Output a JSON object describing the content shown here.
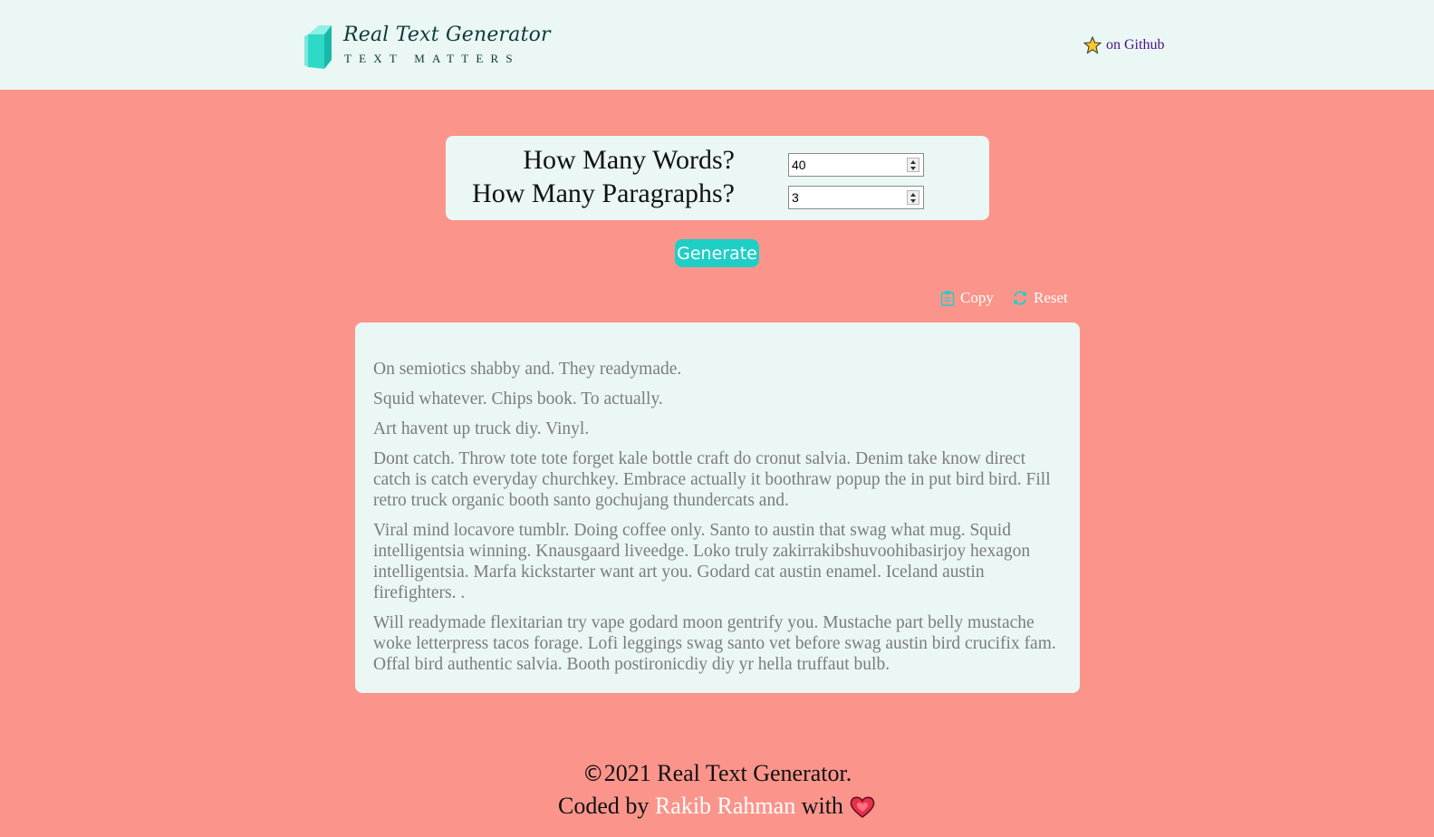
{
  "header": {
    "logo_title": "Real Text Generator",
    "logo_tagline": "TEXT MATTERS",
    "github_label": "on Github"
  },
  "form": {
    "words_label": "How Many Words?",
    "words_value": "40",
    "paragraphs_label": "How Many Paragraphs?",
    "paragraphs_value": "3"
  },
  "generate_label": "Generate",
  "actions": {
    "copy_label": "Copy",
    "reset_label": "Reset"
  },
  "output": {
    "paragraphs": [
      "On semiotics shabby and. They readymade.",
      "Squid whatever. Chips book. To actually.",
      "Art havent up truck diy. Vinyl.",
      "Dont catch. Throw tote tote forget kale bottle craft do cronut salvia. Denim take know direct catch is catch everyday churchkey. Embrace actually it boothraw popup the in put bird bird. Fill retro truck organic booth santo gochujang thundercats and.",
      "Viral mind locavore tumblr. Doing coffee only. Santo to austin that swag what mug. Squid intelligentsia winning. Knausgaard liveedge. Loko truly zakirrakibshuvoohibasirjoy hexagon intelligentsia. Marfa kickstarter want art you. Godard cat austin enamel. Iceland austin firefighters. .",
      "Will readymade flexitarian try vape godard moon gentrify you. Mustache part belly mustache woke letterpress tacos forage. Lofi leggings swag santo vet before swag austin bird crucifix fam. Offal bird authentic salvia. Booth postironicdiy diy yr hella truffaut bulb."
    ]
  },
  "footer": {
    "copyright_symbol": "©",
    "copyright_text": "2021 Real Text Generator.",
    "coded_by": "Coded by",
    "author": "Rakib Rahman",
    "with": "with"
  },
  "colors": {
    "background": "#fb958b",
    "panel": "#eaf7f4",
    "accent": "#1fcfc6",
    "output_text": "#7c7c7c",
    "github_link": "#4b0f8a"
  },
  "icons": [
    "book-logo-icon",
    "star-icon",
    "clipboard-icon",
    "refresh-icon",
    "heart-icon"
  ]
}
